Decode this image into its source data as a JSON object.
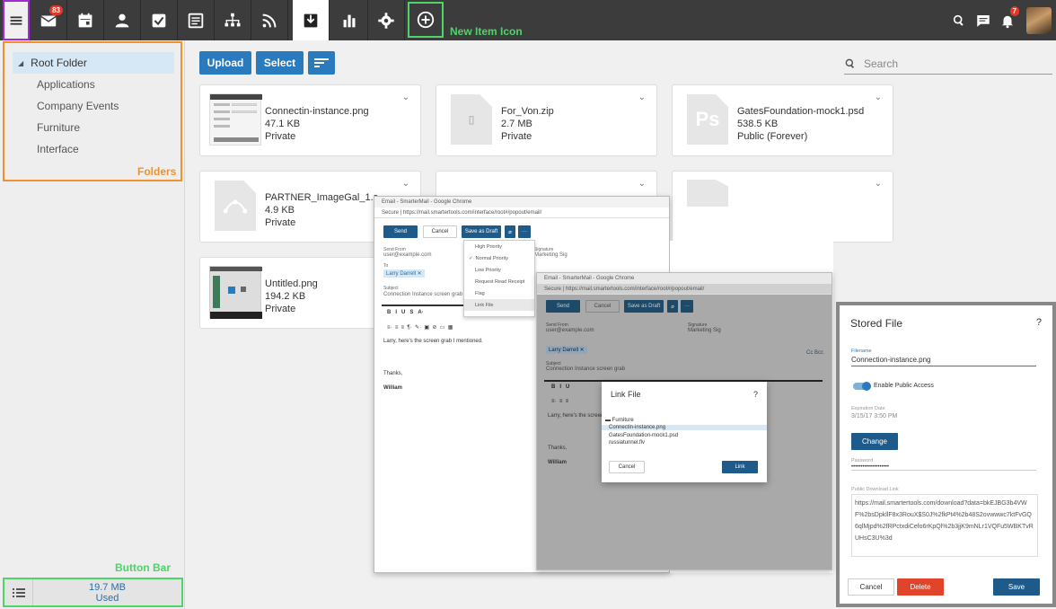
{
  "topbar": {
    "email_badge": "83",
    "notif_badge": "7",
    "new_item_label": "New Item Icon"
  },
  "sidebar": {
    "root_folder": "Root Folder",
    "folders": [
      "Applications",
      "Company Events",
      "Furniture",
      "Interface"
    ],
    "folders_label": "Folders",
    "button_bar_label": "Button Bar",
    "used_size": "19.7 MB",
    "used_label": "Used"
  },
  "toolbar": {
    "upload": "Upload",
    "select": "Select",
    "search_placeholder": "Search"
  },
  "files": [
    {
      "name": "Connectin-instance.png",
      "size": "47.1 KB",
      "access": "Private"
    },
    {
      "name": "For_Von.zip",
      "size": "2.7 MB",
      "access": "Private"
    },
    {
      "name": "GatesFoundation-mock1.psd",
      "size": "538.5 KB",
      "access": "Public (Forever)"
    },
    {
      "name": "PARTNER_ImageGal_1.s",
      "size": "4.9 KB",
      "access": "Private"
    },
    {
      "name": "Untitled.png",
      "size": "194.2 KB",
      "access": "Private"
    }
  ],
  "email1": {
    "title": "Email - SmarterMail - Google Chrome",
    "url": "Secure | https://mail.smartertools.com/interface/root#/popout/email/",
    "send": "Send",
    "cancel": "Cancel",
    "save_draft": "Save as Draft",
    "from_label": "Send From",
    "from_value": "user@example.com",
    "to_label": "To",
    "to_value": "Larry Darrell",
    "subject_label": "Subject",
    "subject_value": "Connection Instance screen grab",
    "signature_label": "Signature",
    "signature_value": "Marketing Sig",
    "body1": "Larry, here's the screen grab I mentioned.",
    "body2": "Thanks,",
    "body3": "William",
    "menu": [
      "High Priority",
      "Normal Priority",
      "Low Priority",
      "Request Read Receipt",
      "Flag",
      "Link File"
    ]
  },
  "email2": {
    "title": "Email - SmarterMail - Google Chrome",
    "url": "Secure | https://mail.smartertools.com/interface/root#/popout/email/",
    "send": "Send",
    "cancel": "Cancel",
    "save_draft": "Save as Draft",
    "from_label": "Send From",
    "from_value": "user@example.com",
    "to_value": "Larry Darrell",
    "subject_label": "Subject",
    "subject_value": "Connection Instance screen grab",
    "signature_label": "Signature",
    "signature_value": "Marketing Sig",
    "ccbcc": "Cc Bcc",
    "body1": "Larry, here's the screen",
    "body2": "Thanks,",
    "body3": "William"
  },
  "link_dialog": {
    "title": "Link File",
    "help": "?",
    "items": [
      "Furniture",
      "Connectin-instance.png",
      "GatesFoundation-mock1.psd",
      "russiatunnel.flv"
    ],
    "cancel": "Cancel",
    "link": "Link"
  },
  "stored_file": {
    "title": "Stored File",
    "help": "?",
    "filename_label": "Filename",
    "filename": "Connection-instance.png",
    "public_access": "Enable Public Access",
    "expiration_label": "Expiration Date",
    "expiration": "3/15/17 3:50 PM",
    "change": "Change",
    "password_label": "Password",
    "password": "••••••••••••••••••••",
    "download_label": "Public Download Link",
    "download_link": "https://mail.smartertools.com/download?data=bkEJBG3b4VWF%2bsDpkllF8x3RouX$S0J%2fkPt4%2b48S2ovwwwc7ktFvGQ6qlMjpd%2fRPctxdiCefo6rKpQl%2b3jjK9mNLr1VQFu5WBKTvRUHsC3U%3d",
    "cancel": "Cancel",
    "delete": "Delete",
    "save": "Save"
  },
  "colors": {
    "topbar": "#3c3c3c",
    "accent": "#2a7bbd",
    "danger": "#e0452c",
    "highlight_purple": "#a02bd6",
    "highlight_green": "#4fd46a",
    "highlight_orange": "#f0922b"
  }
}
